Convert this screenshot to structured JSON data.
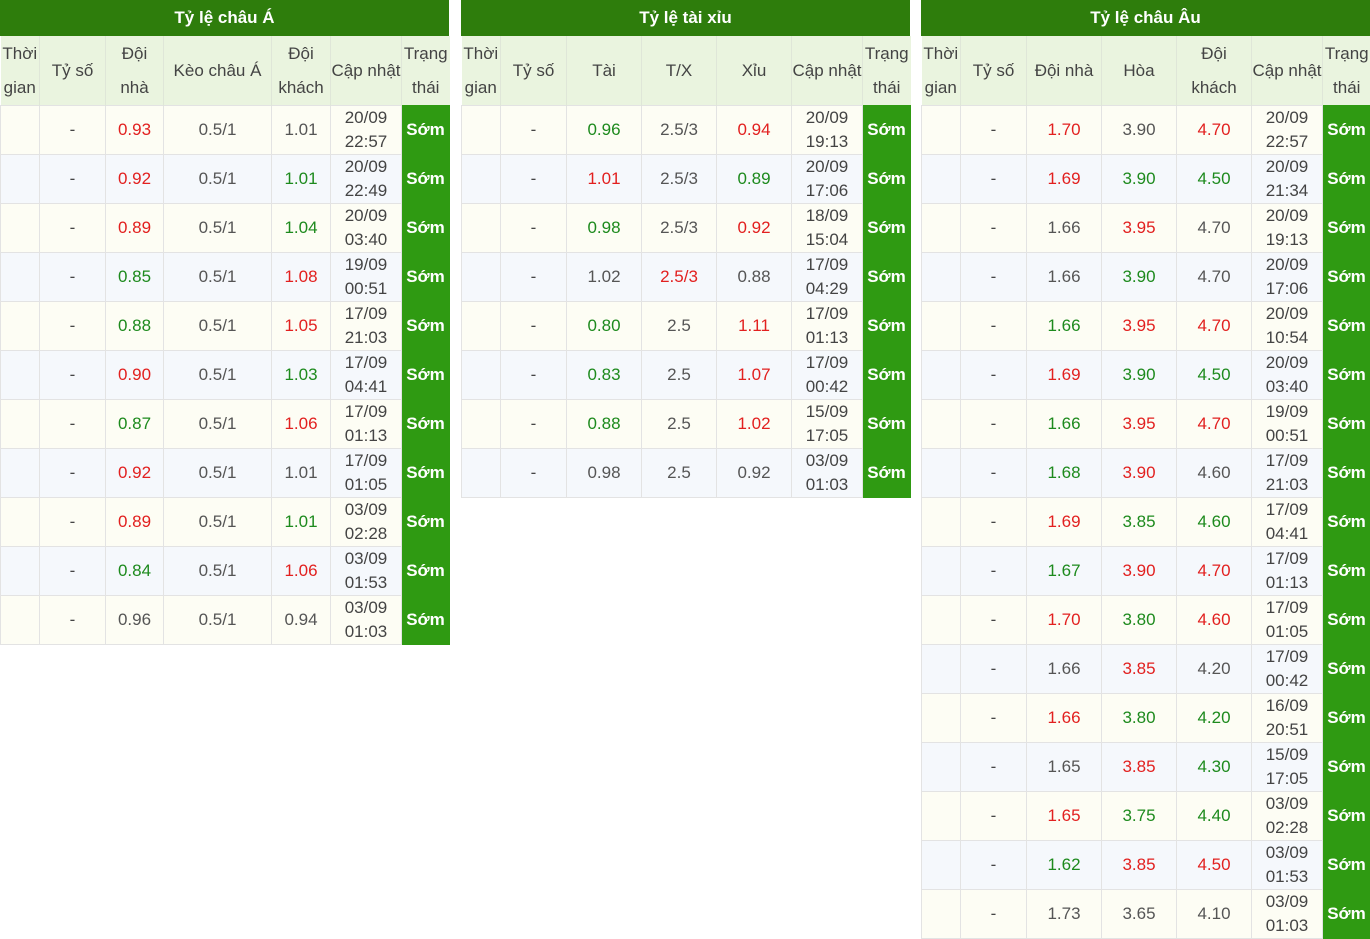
{
  "colors": {
    "header_bg": "#2e7d0c",
    "col_header_bg": "#eaf4df",
    "status_bg": "#2f9a12",
    "up": "#e2201f",
    "down": "#1d8a1d"
  },
  "asian": {
    "title": "Tỷ lệ châu Á",
    "headers": [
      "Thời gian",
      "Tỷ số",
      "Đội nhà",
      "Kèo châu Á",
      "Đội khách",
      "Cập nhật",
      "Trạng thái"
    ],
    "rows": [
      {
        "time": "",
        "score": "-",
        "home": "0.93",
        "home_c": "red",
        "line": "0.5/1",
        "line_c": "plain",
        "away": "1.01",
        "away_c": "plain",
        "update": "20/09 22:57",
        "status": "Sớm"
      },
      {
        "time": "",
        "score": "-",
        "home": "0.92",
        "home_c": "red",
        "line": "0.5/1",
        "line_c": "plain",
        "away": "1.01",
        "away_c": "green",
        "update": "20/09 22:49",
        "status": "Sớm"
      },
      {
        "time": "",
        "score": "-",
        "home": "0.89",
        "home_c": "red",
        "line": "0.5/1",
        "line_c": "plain",
        "away": "1.04",
        "away_c": "green",
        "update": "20/09 03:40",
        "status": "Sớm"
      },
      {
        "time": "",
        "score": "-",
        "home": "0.85",
        "home_c": "green",
        "line": "0.5/1",
        "line_c": "plain",
        "away": "1.08",
        "away_c": "red",
        "update": "19/09 00:51",
        "status": "Sớm"
      },
      {
        "time": "",
        "score": "-",
        "home": "0.88",
        "home_c": "green",
        "line": "0.5/1",
        "line_c": "plain",
        "away": "1.05",
        "away_c": "red",
        "update": "17/09 21:03",
        "status": "Sớm"
      },
      {
        "time": "",
        "score": "-",
        "home": "0.90",
        "home_c": "red",
        "line": "0.5/1",
        "line_c": "plain",
        "away": "1.03",
        "away_c": "green",
        "update": "17/09 04:41",
        "status": "Sớm"
      },
      {
        "time": "",
        "score": "-",
        "home": "0.87",
        "home_c": "green",
        "line": "0.5/1",
        "line_c": "plain",
        "away": "1.06",
        "away_c": "red",
        "update": "17/09 01:13",
        "status": "Sớm"
      },
      {
        "time": "",
        "score": "-",
        "home": "0.92",
        "home_c": "red",
        "line": "0.5/1",
        "line_c": "plain",
        "away": "1.01",
        "away_c": "plain",
        "update": "17/09 01:05",
        "status": "Sớm"
      },
      {
        "time": "",
        "score": "-",
        "home": "0.89",
        "home_c": "red",
        "line": "0.5/1",
        "line_c": "plain",
        "away": "1.01",
        "away_c": "green",
        "update": "03/09 02:28",
        "status": "Sớm"
      },
      {
        "time": "",
        "score": "-",
        "home": "0.84",
        "home_c": "green",
        "line": "0.5/1",
        "line_c": "plain",
        "away": "1.06",
        "away_c": "red",
        "update": "03/09 01:53",
        "status": "Sớm"
      },
      {
        "time": "",
        "score": "-",
        "home": "0.96",
        "home_c": "plain",
        "line": "0.5/1",
        "line_c": "plain",
        "away": "0.94",
        "away_c": "plain",
        "update": "03/09 01:03",
        "status": "Sớm"
      }
    ]
  },
  "overunder": {
    "title": "Tỷ lệ tài xỉu",
    "headers": [
      "Thời gian",
      "Tỷ số",
      "Tài",
      "T/X",
      "Xỉu",
      "Cập nhật",
      "Trạng thái"
    ],
    "rows": [
      {
        "time": "",
        "score": "-",
        "over": "0.96",
        "over_c": "green",
        "line": "2.5/3",
        "line_c": "plain",
        "under": "0.94",
        "under_c": "red",
        "update": "20/09 19:13",
        "status": "Sớm"
      },
      {
        "time": "",
        "score": "-",
        "over": "1.01",
        "over_c": "red",
        "line": "2.5/3",
        "line_c": "plain",
        "under": "0.89",
        "under_c": "green",
        "update": "20/09 17:06",
        "status": "Sớm"
      },
      {
        "time": "",
        "score": "-",
        "over": "0.98",
        "over_c": "green",
        "line": "2.5/3",
        "line_c": "plain",
        "under": "0.92",
        "under_c": "red",
        "update": "18/09 15:04",
        "status": "Sớm"
      },
      {
        "time": "",
        "score": "-",
        "over": "1.02",
        "over_c": "plain",
        "line": "2.5/3",
        "line_c": "red",
        "under": "0.88",
        "under_c": "plain",
        "update": "17/09 04:29",
        "status": "Sớm"
      },
      {
        "time": "",
        "score": "-",
        "over": "0.80",
        "over_c": "green",
        "line": "2.5",
        "line_c": "plain",
        "under": "1.11",
        "under_c": "red",
        "update": "17/09 01:13",
        "status": "Sớm"
      },
      {
        "time": "",
        "score": "-",
        "over": "0.83",
        "over_c": "green",
        "line": "2.5",
        "line_c": "plain",
        "under": "1.07",
        "under_c": "red",
        "update": "17/09 00:42",
        "status": "Sớm"
      },
      {
        "time": "",
        "score": "-",
        "over": "0.88",
        "over_c": "green",
        "line": "2.5",
        "line_c": "plain",
        "under": "1.02",
        "under_c": "red",
        "update": "15/09 17:05",
        "status": "Sớm"
      },
      {
        "time": "",
        "score": "-",
        "over": "0.98",
        "over_c": "plain",
        "line": "2.5",
        "line_c": "plain",
        "under": "0.92",
        "under_c": "plain",
        "update": "03/09 01:03",
        "status": "Sớm"
      }
    ]
  },
  "euro": {
    "title": "Tỷ lệ châu Âu",
    "headers": [
      "Thời gian",
      "Tỷ số",
      "Đội nhà",
      "Hòa",
      "Đội khách",
      "Cập nhật",
      "Trạng thái"
    ],
    "rows": [
      {
        "time": "",
        "score": "-",
        "home": "1.70",
        "home_c": "red",
        "draw": "3.90",
        "draw_c": "plain",
        "away": "4.70",
        "away_c": "red",
        "update": "20/09 22:57",
        "status": "Sớm"
      },
      {
        "time": "",
        "score": "-",
        "home": "1.69",
        "home_c": "red",
        "draw": "3.90",
        "draw_c": "green",
        "away": "4.50",
        "away_c": "green",
        "update": "20/09 21:34",
        "status": "Sớm"
      },
      {
        "time": "",
        "score": "-",
        "home": "1.66",
        "home_c": "plain",
        "draw": "3.95",
        "draw_c": "red",
        "away": "4.70",
        "away_c": "plain",
        "update": "20/09 19:13",
        "status": "Sớm"
      },
      {
        "time": "",
        "score": "-",
        "home": "1.66",
        "home_c": "plain",
        "draw": "3.90",
        "draw_c": "green",
        "away": "4.70",
        "away_c": "plain",
        "update": "20/09 17:06",
        "status": "Sớm"
      },
      {
        "time": "",
        "score": "-",
        "home": "1.66",
        "home_c": "green",
        "draw": "3.95",
        "draw_c": "red",
        "away": "4.70",
        "away_c": "red",
        "update": "20/09 10:54",
        "status": "Sớm"
      },
      {
        "time": "",
        "score": "-",
        "home": "1.69",
        "home_c": "red",
        "draw": "3.90",
        "draw_c": "green",
        "away": "4.50",
        "away_c": "green",
        "update": "20/09 03:40",
        "status": "Sớm"
      },
      {
        "time": "",
        "score": "-",
        "home": "1.66",
        "home_c": "green",
        "draw": "3.95",
        "draw_c": "red",
        "away": "4.70",
        "away_c": "red",
        "update": "19/09 00:51",
        "status": "Sớm"
      },
      {
        "time": "",
        "score": "-",
        "home": "1.68",
        "home_c": "green",
        "draw": "3.90",
        "draw_c": "red",
        "away": "4.60",
        "away_c": "plain",
        "update": "17/09 21:03",
        "status": "Sớm"
      },
      {
        "time": "",
        "score": "-",
        "home": "1.69",
        "home_c": "red",
        "draw": "3.85",
        "draw_c": "green",
        "away": "4.60",
        "away_c": "green",
        "update": "17/09 04:41",
        "status": "Sớm"
      },
      {
        "time": "",
        "score": "-",
        "home": "1.67",
        "home_c": "green",
        "draw": "3.90",
        "draw_c": "red",
        "away": "4.70",
        "away_c": "red",
        "update": "17/09 01:13",
        "status": "Sớm"
      },
      {
        "time": "",
        "score": "-",
        "home": "1.70",
        "home_c": "red",
        "draw": "3.80",
        "draw_c": "green",
        "away": "4.60",
        "away_c": "red",
        "update": "17/09 01:05",
        "status": "Sớm"
      },
      {
        "time": "",
        "score": "-",
        "home": "1.66",
        "home_c": "plain",
        "draw": "3.85",
        "draw_c": "red",
        "away": "4.20",
        "away_c": "plain",
        "update": "17/09 00:42",
        "status": "Sớm"
      },
      {
        "time": "",
        "score": "-",
        "home": "1.66",
        "home_c": "red",
        "draw": "3.80",
        "draw_c": "green",
        "away": "4.20",
        "away_c": "green",
        "update": "16/09 20:51",
        "status": "Sớm"
      },
      {
        "time": "",
        "score": "-",
        "home": "1.65",
        "home_c": "plain",
        "draw": "3.85",
        "draw_c": "red",
        "away": "4.30",
        "away_c": "green",
        "update": "15/09 17:05",
        "status": "Sớm"
      },
      {
        "time": "",
        "score": "-",
        "home": "1.65",
        "home_c": "red",
        "draw": "3.75",
        "draw_c": "green",
        "away": "4.40",
        "away_c": "green",
        "update": "03/09 02:28",
        "status": "Sớm"
      },
      {
        "time": "",
        "score": "-",
        "home": "1.62",
        "home_c": "green",
        "draw": "3.85",
        "draw_c": "red",
        "away": "4.50",
        "away_c": "red",
        "update": "03/09 01:53",
        "status": "Sớm"
      },
      {
        "time": "",
        "score": "-",
        "home": "1.73",
        "home_c": "plain",
        "draw": "3.65",
        "draw_c": "plain",
        "away": "4.10",
        "away_c": "plain",
        "update": "03/09 01:03",
        "status": "Sớm"
      }
    ]
  }
}
